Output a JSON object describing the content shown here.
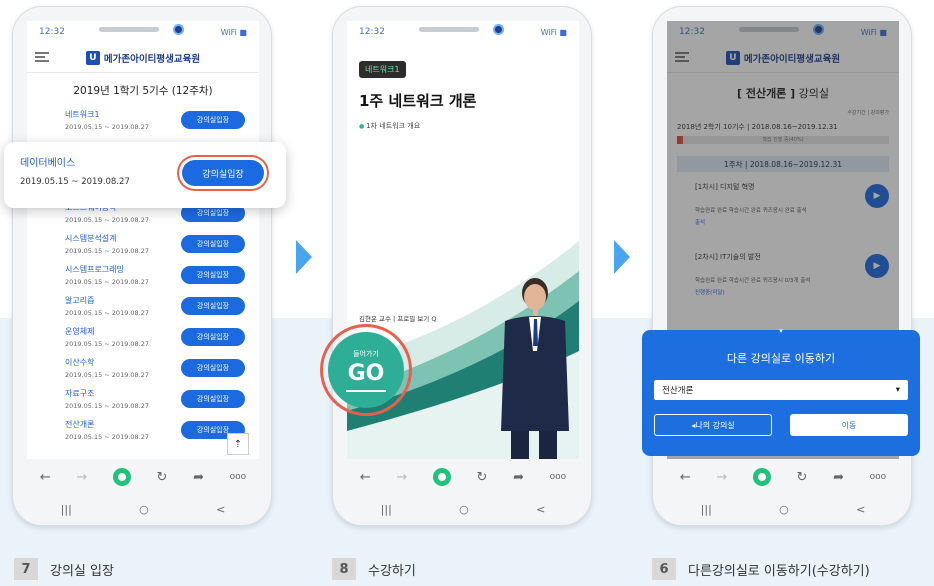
{
  "status_time": "12:32",
  "status_icons": "WiFi ■",
  "brand": {
    "badge": "U",
    "name": "메가존아이티평생교육원"
  },
  "icons": [
    "menu-icon",
    "back-arrow-icon",
    "forward-arrow-icon",
    "home-icon",
    "refresh-icon",
    "share-icon",
    "more-icon",
    "recent-apps-icon",
    "home-nav-icon",
    "back-nav-icon",
    "up-arrow-icon",
    "play-icon",
    "chevron-down-icon"
  ],
  "phone1": {
    "term_title": "2019년 1학기 5기수 (12주차)",
    "courses": [
      {
        "name": "네트워크1",
        "date": "2019.05.15 ~ 2019.08.27",
        "btn": "강의실입장"
      },
      {
        "name": "",
        "date": "2019.05.15 ~ 2019.08.27",
        "btn": "강의실입장"
      },
      {
        "name": "",
        "date": "",
        "btn": ""
      },
      {
        "name": "소프트웨어공학",
        "date": "2019.05.15 ~ 2019.08.27",
        "btn": "강의실입장"
      },
      {
        "name": "시스템분석설계",
        "date": "2019.05.15 ~ 2019.08.27",
        "btn": "강의실입장"
      },
      {
        "name": "시스템프로그래밍",
        "date": "2019.05.15 ~ 2019.08.27",
        "btn": "강의실입장"
      },
      {
        "name": "알고리즘",
        "date": "2019.05.15 ~ 2019.08.27",
        "btn": "강의실입장"
      },
      {
        "name": "운영체제",
        "date": "2019.05.15 ~ 2019.08.27",
        "btn": "강의실입장"
      },
      {
        "name": "이산수학",
        "date": "2019.05.15 ~ 2019.08.27",
        "btn": "강의실입장"
      },
      {
        "name": "자료구조",
        "date": "2019.05.15 ~ 2019.08.27",
        "btn": "강의실입장"
      },
      {
        "name": "전산개론",
        "date": "2019.05.15 ~ 2019.08.27",
        "btn": "강의실입장"
      }
    ],
    "highlight": {
      "name": "데이터베이스",
      "date": "2019.05.15 ~ 2019.08.27",
      "btn": "강의실입장"
    },
    "top_btn": "⇡"
  },
  "phone2": {
    "tag": "네트워크1",
    "title": "1주 네트워크 개론",
    "subtitle": "1차 네트워크 개요",
    "teacher": "김현운 교수  |  프로필 보기 Q",
    "go_small": "들어가기",
    "go_big": "GO"
  },
  "phone3": {
    "crumb_bold": "[ 전산개론 ]",
    "crumb_rest": " 강의실",
    "mini_tabs": "수강기간 | 강의평가",
    "semester": "2018년 2학기 10기수 | 2018.08.16~2019.12.31",
    "progress_label": "학습 진행 중(40%)",
    "week": "1주차 | 2018.08.16~2019.12.31",
    "sessions": [
      {
        "title": "[1차시] 디지털 혁명",
        "meta": "학습완료  완료  학습시간  완료  퀴즈응시  완료  출석",
        "extra": "출석"
      },
      {
        "title": "[2차시] IT기술의 발전",
        "meta": "학습완료  완료  학습시간  완료  퀴즈응시  0/3개  출석",
        "extra": "진행중(미달)"
      }
    ],
    "popup": {
      "title": "다른 강의실로 이동하기",
      "select_value": "전산개론",
      "btn_my": "◂나의 강의실",
      "btn_move": "이동",
      "handle": "▾"
    }
  },
  "captions": [
    {
      "num": "7",
      "text": "강의실 입장"
    },
    {
      "num": "8",
      "text": "수강하기"
    },
    {
      "num": "6",
      "text": "다른강의실로 이동하기(수강하기)"
    }
  ],
  "colors": {
    "accent": "#1c6ae0",
    "go": "#2fae97",
    "highlight_ring": "#e8604d",
    "band": "#eaf2fa"
  }
}
